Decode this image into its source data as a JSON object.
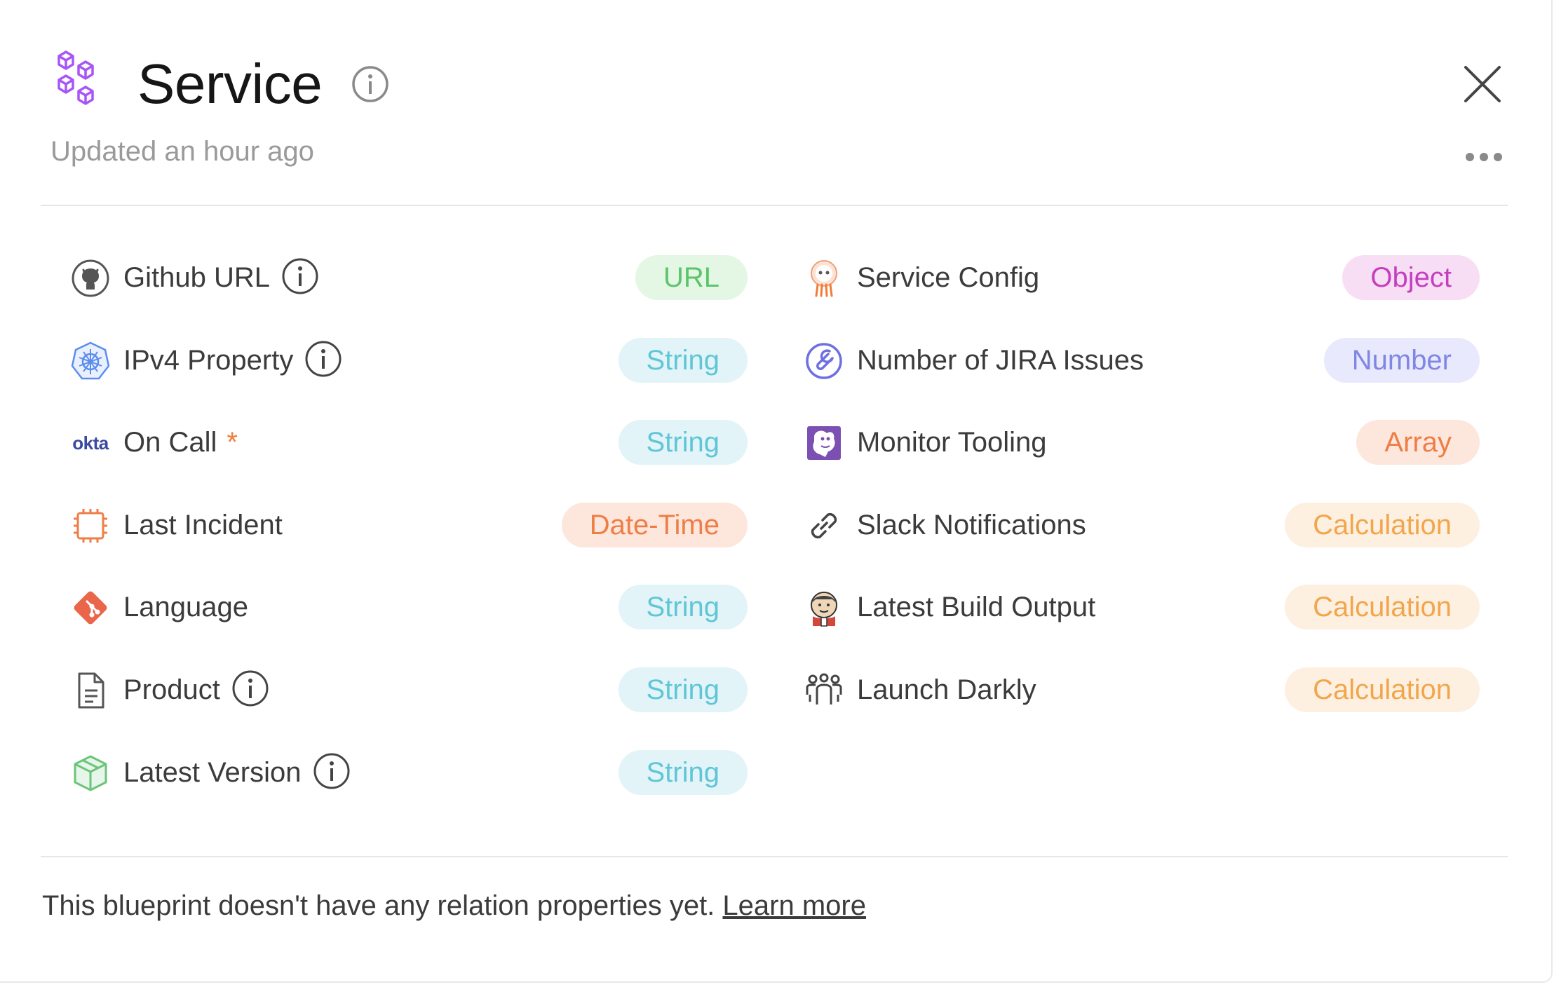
{
  "header": {
    "title": "Service",
    "updated": "Updated an hour ago"
  },
  "colors": {
    "url_bg": "#e3f7e4",
    "url_fg": "#5cc46a",
    "string_bg": "#e2f4f8",
    "string_fg": "#5fc6d6",
    "datetime_bg": "#fde6dc",
    "datetime_fg": "#ee7e46",
    "object_bg": "#f8def4",
    "object_fg": "#c43fc0",
    "number_bg": "#e8e9fc",
    "number_fg": "#7f86e4",
    "array_bg": "#fde7dc",
    "array_fg": "#ee7e46",
    "calc_bg": "#fdf0e1",
    "calc_fg": "#f2a64c"
  },
  "properties_left": [
    {
      "label": "Github URL",
      "type": "URL",
      "icon": "github-icon"
    },
    {
      "label": "IPv4 Property",
      "type": "String",
      "icon": "kubernetes-icon"
    },
    {
      "label": "On Call",
      "required_mark": "*",
      "type": "String",
      "icon": "okta-icon",
      "icon_text": "okta"
    },
    {
      "label": "Last Incident",
      "type": "Date-Time",
      "icon": "microchip-icon"
    },
    {
      "label": "Language",
      "type": "String",
      "icon": "git-icon"
    },
    {
      "label": "Product",
      "type": "String",
      "icon": "document-icon"
    },
    {
      "label": "Latest Version",
      "type": "String",
      "icon": "package-icon"
    }
  ],
  "properties_right": [
    {
      "label": "Service Config",
      "type": "Object",
      "icon": "argo-icon"
    },
    {
      "label": "Number of JIRA Issues",
      "type": "Number",
      "icon": "wrench-icon"
    },
    {
      "label": "Monitor Tooling",
      "type": "Array",
      "icon": "datadog-icon"
    },
    {
      "label": "Slack Notifications",
      "type": "Calculation",
      "icon": "link-icon"
    },
    {
      "label": "Latest Build Output",
      "type": "Calculation",
      "icon": "jenkins-icon"
    },
    {
      "label": "Launch Darkly",
      "type": "Calculation",
      "icon": "team-icon"
    }
  ],
  "footer": {
    "text": "This blueprint doesn't have any relation properties yet. ",
    "link": "Learn more"
  }
}
